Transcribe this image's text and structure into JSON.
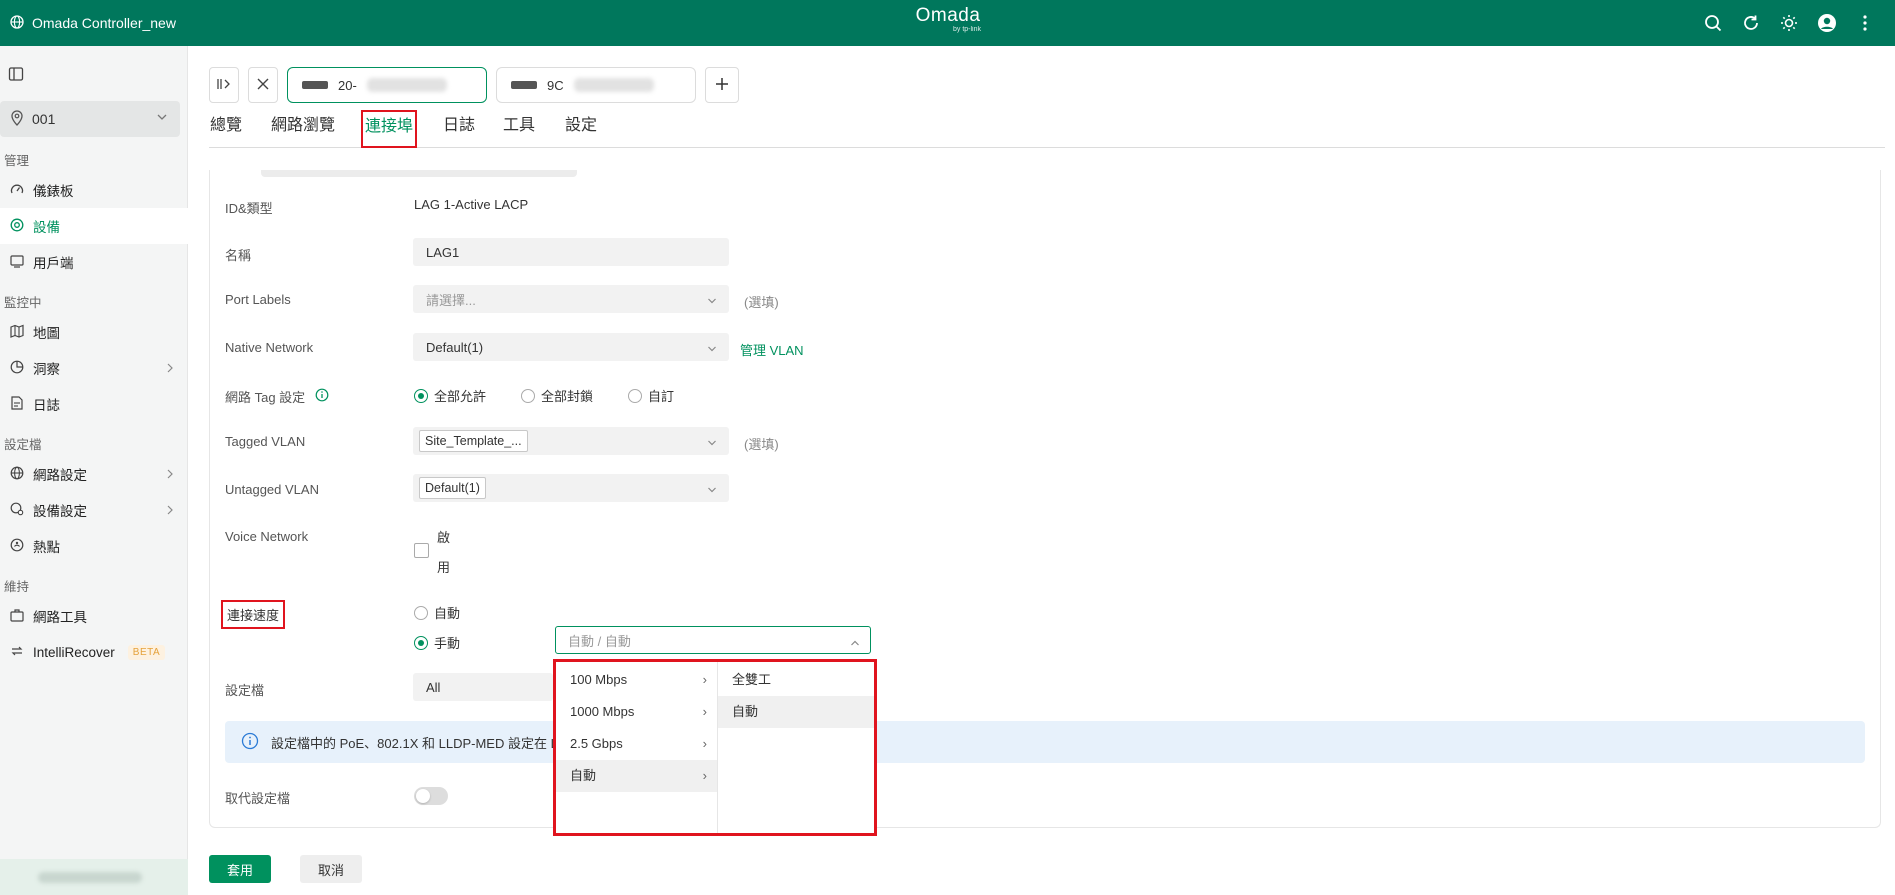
{
  "topbar": {
    "app_name": "Omada Controller_new",
    "brand": "Omada",
    "brand_sub": "by tp-link",
    "colors": {
      "bar": "#00775c",
      "accent": "#00915e"
    }
  },
  "sidebar": {
    "site": "001",
    "groups": {
      "manage": "管理",
      "monitor": "監控中",
      "config": "設定檔",
      "maintain": "維持"
    },
    "items": {
      "dashboard": "儀錶板",
      "devices": "設備",
      "clients": "用戶端",
      "map": "地圖",
      "insight": "洞察",
      "logs": "日誌",
      "network_settings": "網路設定",
      "device_settings": "設備設定",
      "hotspot": "熱點",
      "network_tools": "網路工具",
      "intellirecover": "IntelliRecover",
      "beta": "BETA"
    }
  },
  "device_tabs": [
    {
      "prefix": "20-"
    },
    {
      "prefix": "9C"
    }
  ],
  "nav_tabs": {
    "overview": "總覽",
    "network_browse": "網路瀏覽",
    "ports": "連接埠",
    "logs": "日誌",
    "tools": "工具",
    "settings": "設定"
  },
  "form": {
    "id_type_label": "ID&類型",
    "id_type_value": "LAG 1-Active LACP",
    "name_label": "名稱",
    "name_value": "LAG1",
    "port_labels_label": "Port Labels",
    "port_labels_placeholder": "請選擇...",
    "optional": "(選填)",
    "native_network_label": "Native Network",
    "native_network_value": "Default(1)",
    "manage_vlan_link": "管理 VLAN",
    "tag_setting_label": "網路 Tag 設定",
    "tag_options": {
      "allow_all": "全部允許",
      "block_all": "全部封鎖",
      "custom": "自訂"
    },
    "tagged_vlan_label": "Tagged VLAN",
    "tagged_vlan_chip": "Site_Template_...",
    "untagged_vlan_label": "Untagged VLAN",
    "untagged_vlan_chip": "Default(1)",
    "voice_network_label": "Voice Network",
    "voice_enable_1": "啟",
    "voice_enable_2": "用",
    "link_speed_label": "連接速度",
    "link_speed_auto": "自動",
    "link_speed_manual": "手動",
    "link_speed_value": "自動 / 自動",
    "profile_label": "設定檔",
    "profile_value": "All",
    "info_text": "設定檔中的 PoE、802.1X 和 LLDP-MED 設定在 LAG",
    "override_label": "取代設定檔"
  },
  "cascader": {
    "speeds": [
      "100 Mbps",
      "1000 Mbps",
      "2.5 Gbps",
      "自動"
    ],
    "duplex": [
      "全雙工",
      "自動"
    ]
  },
  "actions": {
    "apply": "套用",
    "cancel": "取消"
  }
}
